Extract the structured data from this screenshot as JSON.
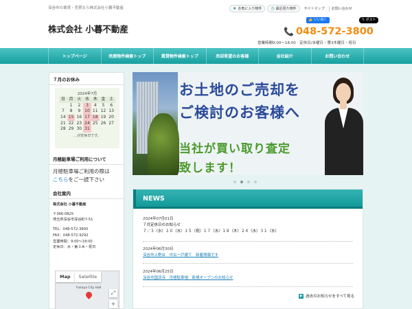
{
  "header": {
    "tagline": "深谷市の賃貸・売買なら株式会社小暮不動産",
    "favorites_label": "お気に入り物件",
    "recent_label": "最近見た物件",
    "sitemap_label": "サイトマップ",
    "contact_link_label": "お問い合わせ",
    "company_name": "株式会社 小暮不動産",
    "facebook_label": "いいね！",
    "x_post_label": "ポスト",
    "phone": "048-572-3800",
    "hours": "営業時間9:00～18:00　定休日/水曜日・第3木曜日・祝日"
  },
  "nav": {
    "items": [
      {
        "label": "トップページ"
      },
      {
        "label": "売買物件検索トップ"
      },
      {
        "label": "賃貸物件検索トップ"
      },
      {
        "label": "売却希望のお客様"
      },
      {
        "label": "会社紹介"
      },
      {
        "label": "お問い合わせ"
      }
    ]
  },
  "sidebar": {
    "holiday_heading": "７月のお休み",
    "calendar": {
      "title": "2024年7月",
      "weekdays": [
        "日",
        "月",
        "火",
        "水",
        "木",
        "金",
        "土"
      ],
      "note": "…が定休日です。"
    },
    "parking_heading": "月極駐車場ご利用について",
    "parking_text_before": "月極駐車場ご利用の際は",
    "parking_link": "こちら",
    "parking_text_after": "をご一読下さい",
    "company_heading": "会社案内",
    "company_name": "株式会社 小暮不動産",
    "postal": "〒366-0825",
    "address": "埼玉県深谷市深谷町7-51",
    "tel": "TEL：048-572-3800",
    "fax": "FAX：048-572-9292",
    "hours": "営業時間：9:00～18:00",
    "closed": "定休日：水・第３木・祝日",
    "map": {
      "tab_map": "Map",
      "tab_satellite": "Satellite",
      "label": "Fukaya City Hall",
      "zoom_in": "+"
    }
  },
  "hero": {
    "line1": "お土地のご売却を",
    "line2": "ご検討のお客様へ",
    "line3": "当社が買い取り査定",
    "line4": "致します！"
  },
  "news": {
    "heading": "NEWS",
    "items": [
      {
        "date": "2024年07月01日",
        "title": "７月定休日のお知らせ",
        "body": "７／３（水）１０（水）１５（祝）１７（水）１８（木）２４（水）３１（水）"
      },
      {
        "date": "2024年06月30日",
        "title": "深谷市上野台　中古一戸建て　新着情報です"
      },
      {
        "date": "2024年06月25日",
        "title": "深谷市国済寺　月極駐車場　新規オープンのお知らせ"
      }
    ],
    "see_all": "過去のお知らせをすべて見る"
  }
}
